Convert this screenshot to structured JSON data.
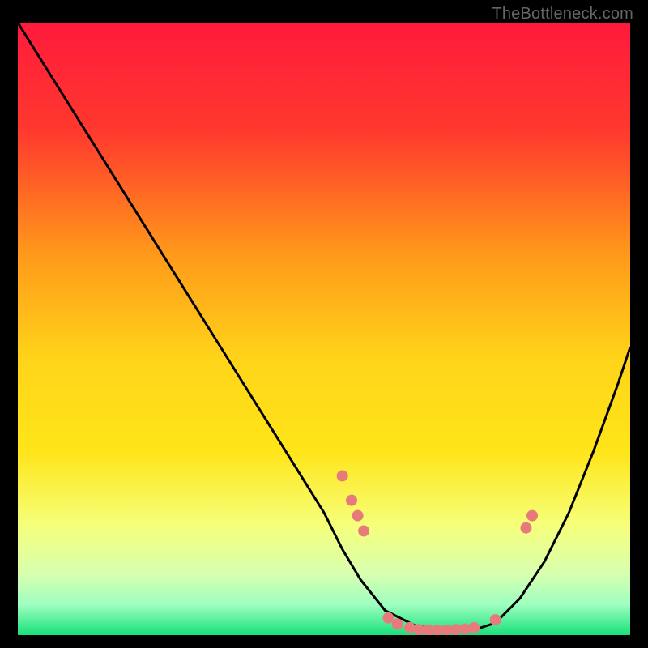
{
  "watermark": "TheBottleneck.com",
  "chart_data": {
    "type": "line",
    "title": "",
    "xlabel": "",
    "ylabel": "",
    "xlim": [
      0,
      100
    ],
    "ylim": [
      0,
      100
    ],
    "background_gradient": {
      "top": "#ff1a3c",
      "upper_mid": "#ff7a1f",
      "mid": "#ffe519",
      "lower_mid": "#f6ff7a",
      "bottom": "#18e07a"
    },
    "series": [
      {
        "name": "bottleneck-curve",
        "stroke": "#000000",
        "x": [
          0,
          5,
          10,
          15,
          20,
          25,
          30,
          35,
          40,
          45,
          50,
          53,
          56,
          60,
          65,
          70,
          75,
          78,
          82,
          86,
          90,
          94,
          98,
          100
        ],
        "y": [
          100,
          92,
          84,
          76,
          68,
          60,
          52,
          44,
          36,
          28,
          20,
          14,
          9,
          4,
          1.5,
          0.8,
          1.0,
          2.0,
          6,
          12,
          20,
          30,
          41,
          47
        ]
      }
    ],
    "markers": {
      "color": "#e77b7b",
      "radius": 7,
      "points": [
        {
          "x": 53.0,
          "y": 26.0
        },
        {
          "x": 54.5,
          "y": 22.0
        },
        {
          "x": 55.5,
          "y": 19.5
        },
        {
          "x": 56.5,
          "y": 17.0
        },
        {
          "x": 60.5,
          "y": 2.8
        },
        {
          "x": 62.0,
          "y": 1.8
        },
        {
          "x": 64.0,
          "y": 1.2
        },
        {
          "x": 65.5,
          "y": 0.9
        },
        {
          "x": 67.0,
          "y": 0.8
        },
        {
          "x": 68.5,
          "y": 0.8
        },
        {
          "x": 70.0,
          "y": 0.8
        },
        {
          "x": 71.5,
          "y": 0.9
        },
        {
          "x": 73.0,
          "y": 1.0
        },
        {
          "x": 74.5,
          "y": 1.2
        },
        {
          "x": 78.0,
          "y": 2.5
        },
        {
          "x": 83.0,
          "y": 17.5
        },
        {
          "x": 84.0,
          "y": 19.5
        }
      ]
    }
  }
}
